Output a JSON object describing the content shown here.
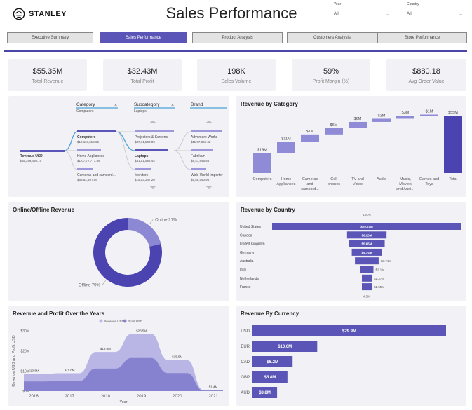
{
  "brand": {
    "name": "STANLEY"
  },
  "header": {
    "title": "Sales Performance"
  },
  "filters": {
    "year": {
      "label": "Year",
      "value": "All"
    },
    "country": {
      "label": "Country",
      "value": "All"
    }
  },
  "nav": {
    "tabs": [
      "Executive Summary",
      "Sales Performance",
      "Product Analysis",
      "Customers Analysis",
      "Store Performance"
    ],
    "active": "Sales Performance"
  },
  "kpis": [
    {
      "value": "$55.35M",
      "label": "Total Revenue"
    },
    {
      "value": "$32.43M",
      "label": "Total Profit"
    },
    {
      "value": "198K",
      "label": "Sales Volume"
    },
    {
      "value": "59%",
      "label": "Profit Margin (%)"
    },
    {
      "value": "$880.18",
      "label": "Avg Order Value"
    }
  ],
  "decomp": {
    "columns": [
      {
        "header": "Category",
        "selected": "Computers"
      },
      {
        "header": "Subcategory",
        "selected": "Laptops"
      },
      {
        "header": "Brand",
        "selected": ""
      }
    ],
    "root": {
      "label": "Revenue USD",
      "value": "$55,349,466.10"
    },
    "categories": [
      {
        "label": "Computers",
        "value": "$19,113,319.65",
        "bold": true
      },
      {
        "label": "Home Appliances",
        "value": "$1,07,77,777.59",
        "bold": false
      },
      {
        "label": "Cameras and camcord...",
        "value": "$65,82,407.56",
        "bold": false
      }
    ],
    "subcategories": [
      {
        "label": "Projectors & Screens",
        "value": "$37,71,500.00",
        "bold": false
      },
      {
        "label": "Laptops",
        "value": "$31,51,582.44",
        "bold": true
      },
      {
        "label": "Monitors",
        "value": "$15,03,347.20",
        "bold": false
      }
    ],
    "brands": [
      {
        "label": "Adventure Works",
        "value": "$11,97,836.02"
      },
      {
        "label": "Fabrikam",
        "value": "$8,47,845.86"
      },
      {
        "label": "Wide World Importer",
        "value": "$5,85,540.96"
      }
    ]
  },
  "panels": {
    "category": "Revenue by Category",
    "online": "Online/Offline Revenue",
    "country": "Revenue by Country",
    "years": "Revenue and Profit Over the Years",
    "currency": "Revenue By Currency"
  },
  "chart_data": [
    {
      "id": "category",
      "type": "bar",
      "subtype": "waterfall",
      "categories": [
        "Computers",
        "Home Appliances",
        "Cameras and camcord...",
        "Cell phones",
        "TV and Video",
        "Audio",
        "Music, Movies and Audi...",
        "Games and Toys",
        "Total"
      ],
      "tick_labels": [
        [
          "Computers"
        ],
        [
          "Home",
          "Appliances"
        ],
        [
          "Cameras",
          "and",
          "camcord..."
        ],
        [
          "Cell",
          "phones"
        ],
        [
          "TV and",
          "Video"
        ],
        [
          "Audio"
        ],
        [
          "Music,",
          "Movies",
          "and Audi..."
        ],
        [
          "Games and",
          "Toys"
        ],
        [
          "Total"
        ]
      ],
      "values": [
        19,
        11,
        7,
        6,
        6,
        3,
        3,
        1,
        55
      ],
      "data_labels": [
        "$19M",
        "$11M",
        "$7M",
        "$6M",
        "$6M",
        "$3M",
        "$3M",
        "$1M",
        "$55M"
      ],
      "ylim": [
        0,
        55
      ],
      "colors": {
        "step": "#8f8bd6",
        "total": "#4a43b0"
      }
    },
    {
      "id": "online",
      "type": "pie",
      "subtype": "donut",
      "labels": [
        "Online",
        "Offline"
      ],
      "values": [
        21,
        79
      ],
      "slice_labels": [
        "Online 21%",
        "Offline 79%"
      ],
      "colors": [
        "#8c88d4",
        "#4a43b0"
      ]
    },
    {
      "id": "country",
      "type": "bar",
      "subtype": "funnel",
      "categories": [
        "United States",
        "Canada",
        "United Kingdom",
        "Germany",
        "Australia",
        "Italy",
        "Netherlands",
        "France"
      ],
      "values": [
        29.87,
        6.23,
        5.65,
        4.74,
        3.74,
        2.1,
        1.37,
        1.05
      ],
      "data_labels": [
        "$29.87M",
        "$6.23M",
        "$5.65M",
        "$4.74M",
        "$3.74M",
        "$2.1M",
        "$1.37M",
        "$1.05M"
      ],
      "top_label": "100%",
      "bottom_label": "4.5%",
      "color": "#5a55b6"
    },
    {
      "id": "years",
      "type": "area",
      "subtype": "ribbon",
      "x": [
        "2016",
        "2017",
        "2018",
        "2019",
        "2020",
        "2021"
      ],
      "series": [
        {
          "name": "Revenue USD",
          "values": [
            8.5,
            8.9,
            19.5,
            28.5,
            15.5,
            0.5
          ],
          "labels": [
            "$10.8M",
            "$11.8M",
            "$19.6M",
            "$28.5M",
            "$15.5M",
            "$1.4M"
          ]
        },
        {
          "name": "Profit USD",
          "values": [
            4.8,
            5.0,
            11.2,
            16.5,
            9.0,
            0.3
          ]
        }
      ],
      "ylabel": "Revenue USD and Profit USD",
      "xlabel": "Year",
      "yticks": [
        "$0M",
        "$10M",
        "$20M",
        "$30M"
      ],
      "ylim": [
        0,
        30
      ],
      "colors": [
        "#b9b6e6",
        "#8682d0"
      ]
    },
    {
      "id": "currency",
      "type": "bar",
      "orientation": "horizontal",
      "categories": [
        "USD",
        "EUR",
        "CAD",
        "GBP",
        "AUD"
      ],
      "values": [
        29.9,
        10.0,
        6.2,
        5.4,
        3.8
      ],
      "data_labels": [
        "$29.9M",
        "$10.0M",
        "$6.2M",
        "$5.4M",
        "$3.8M"
      ],
      "color": "#5a55b6"
    }
  ]
}
